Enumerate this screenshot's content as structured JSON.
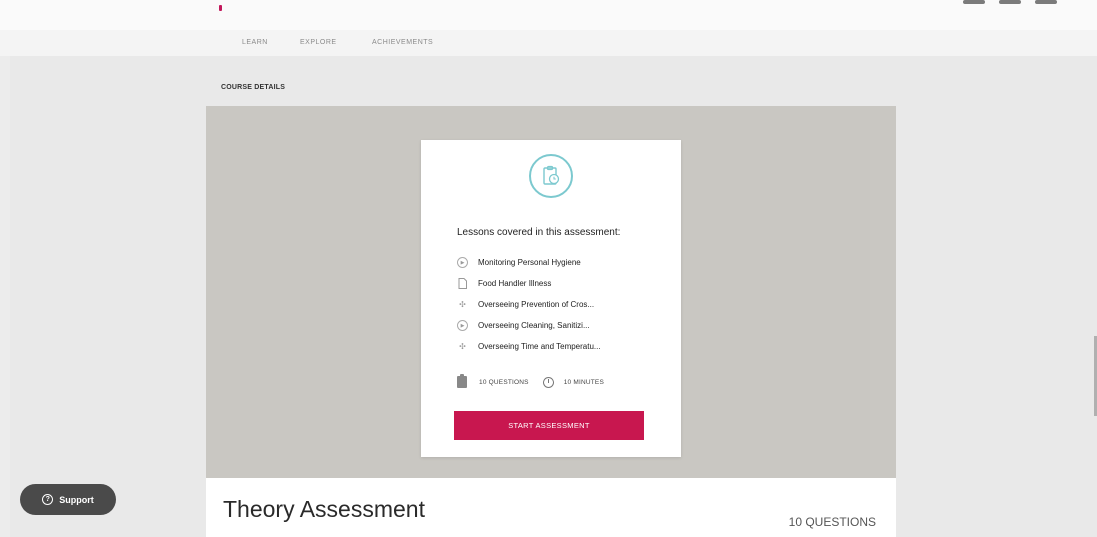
{
  "nav": {
    "tabs": [
      {
        "label": "LEARN"
      },
      {
        "label": "EXPLORE"
      },
      {
        "label": "ACHIEVEMENTS"
      }
    ]
  },
  "section": {
    "label": "COURSE DETAILS"
  },
  "card": {
    "icon": "clipboard-clock-icon",
    "heading": "Lessons covered in this assessment:",
    "lessons": [
      {
        "icon": "play-icon",
        "label": "Monitoring Personal Hygiene"
      },
      {
        "icon": "document-icon",
        "label": "Food Handler Illness"
      },
      {
        "icon": "puzzle-icon",
        "label": "Overseeing Prevention of Cros..."
      },
      {
        "icon": "play-icon",
        "label": "Overseeing Cleaning, Sanitizi..."
      },
      {
        "icon": "puzzle-icon",
        "label": "Overseeing Time and Temperatu..."
      }
    ],
    "questions_label": "10 QUESTIONS",
    "minutes_label": "10 MINUTES",
    "start_button_label": "START ASSESSMENT"
  },
  "course": {
    "title": "Theory Assessment",
    "questions_count": "10 QUESTIONS"
  },
  "support": {
    "label": "Support",
    "icon": "question-icon"
  },
  "colors": {
    "accent": "#c8174f",
    "icon_teal": "#7cc9cf",
    "hero_bg": "#c9c7c2"
  }
}
